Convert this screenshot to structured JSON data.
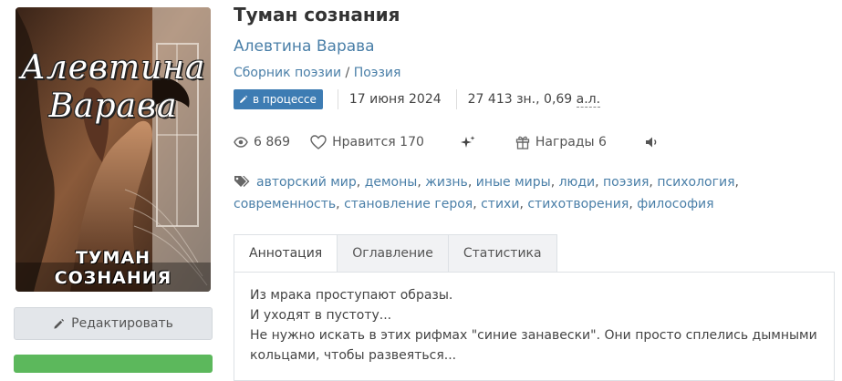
{
  "cover": {
    "author_text": "Алевтина Варава",
    "title_text": "ТУМАН СОЗНАНИЯ"
  },
  "book": {
    "title": "Туман сознания",
    "author": "Алевтина Варава",
    "collection_type": "Сборник поэзии",
    "genre_separator": "/",
    "genre": "Поэзия",
    "status": "в процессе",
    "date": "17 июня 2024",
    "chars": "27 413 зн.,",
    "sheets_value": "0,69",
    "sheets_unit": "а.л."
  },
  "stats": {
    "views": "6 869",
    "likes_label": "Нравится",
    "likes": "170",
    "awards_label": "Награды",
    "awards": "6"
  },
  "tags": [
    "авторский мир",
    "демоны",
    "жизнь",
    "иные миры",
    "люди",
    "поэзия",
    "психология",
    "современность",
    "становление героя",
    "стихи",
    "стихотворения",
    "философия"
  ],
  "tabs": [
    {
      "label": "Аннотация",
      "active": true
    },
    {
      "label": "Оглавление",
      "active": false
    },
    {
      "label": "Статистика",
      "active": false
    }
  ],
  "annotation": [
    "Из мрака проступают образы.",
    "И уходят в пустоту...",
    "Не нужно искать в этих рифмах \"синие занавески\". Они просто сплелись дымными кольцами, чтобы развеяться..."
  ],
  "buttons": {
    "edit_label": "Редактировать"
  },
  "colors": {
    "link": "#4a7fa8",
    "badge": "#3d7cb3",
    "green_button": "#5cb85c"
  }
}
